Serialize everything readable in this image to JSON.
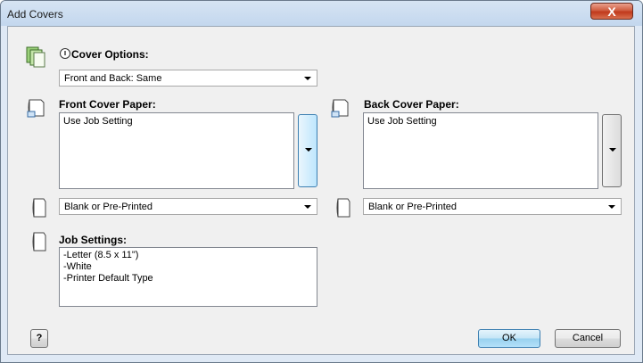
{
  "window": {
    "title": "Add Covers",
    "close_label": "X"
  },
  "cover_options": {
    "label": "Cover Options:",
    "selected": "Front and Back: Same"
  },
  "front_cover": {
    "label": "Front Cover Paper:",
    "items": [
      "Use Job Setting"
    ],
    "type_selected": "Blank or Pre-Printed"
  },
  "back_cover": {
    "label": "Back Cover Paper:",
    "items": [
      "Use Job Setting"
    ],
    "type_selected": "Blank or Pre-Printed"
  },
  "job_settings": {
    "label": "Job Settings:",
    "lines": [
      "-Letter (8.5 x 11\")",
      "-White",
      "-Printer Default Type"
    ]
  },
  "buttons": {
    "help": "?",
    "ok": "OK",
    "cancel": "Cancel"
  }
}
